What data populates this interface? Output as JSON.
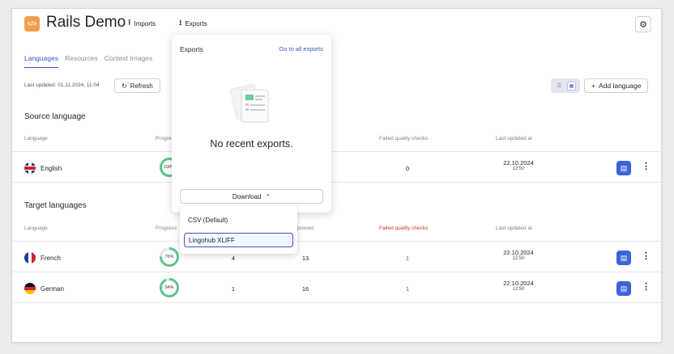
{
  "header": {
    "logo_glyph": "</>",
    "app_title": "Rails Demo",
    "imports_label": "Imports",
    "exports_label": "Exports",
    "settings_icon": "gear-icon"
  },
  "tabs": [
    {
      "label": "Languages",
      "active": true
    },
    {
      "label": "Resources",
      "active": false
    },
    {
      "label": "Context Images",
      "active": false
    }
  ],
  "toolbar": {
    "last_updated": "Last updated: 01.11.2024, 11:04",
    "refresh_label": "Refresh",
    "add_language_label": "Add language"
  },
  "source": {
    "title": "Source language",
    "columns": {
      "language": "Language",
      "progress": "Progress",
      "failed": "Failed quality checks",
      "last_updated": "Last updated at"
    },
    "rows": [
      {
        "language": "English",
        "progress": "100%",
        "progress_value": 100,
        "failed": "0",
        "date": "22.10.2024",
        "time": "12:50"
      }
    ]
  },
  "target": {
    "title": "Target languages",
    "columns": {
      "language": "Language",
      "progress": "Progress",
      "approved": "Approved",
      "failed": "Failed quality checks",
      "last_updated": "Last updated at"
    },
    "rows": [
      {
        "language": "French",
        "progress": "76%",
        "progress_value": 76,
        "col3": "4",
        "approved": "13",
        "failed": "1",
        "date": "22.10.2024",
        "time": "12:50"
      },
      {
        "language": "German",
        "progress": "94%",
        "progress_value": 94,
        "col3": "1",
        "approved": "16",
        "failed": "1",
        "date": "22.10.2024",
        "time": "12:50"
      }
    ]
  },
  "exports_popup": {
    "title": "Exports",
    "link": "Go to all exports",
    "empty_text": "No recent exports.",
    "download_label": "Download"
  },
  "download_menu": {
    "items": [
      "CSV (Default)",
      "Lingohub XLIFF"
    ],
    "selected": "Lingohub XLIFF"
  },
  "colors": {
    "accent": "#3a57c7",
    "action": "#3d63d8",
    "progress": "#5cc48a",
    "error": "#c0392b",
    "logo": "#f0a04b"
  }
}
